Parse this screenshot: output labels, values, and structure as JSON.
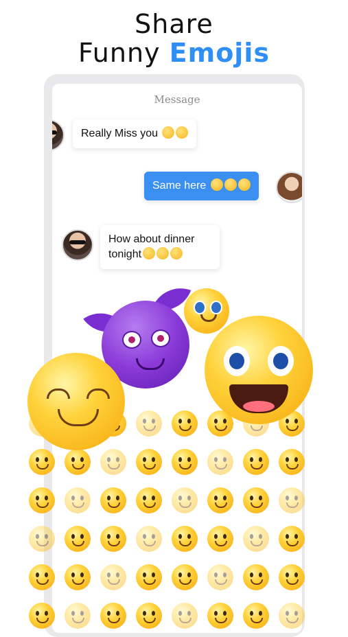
{
  "headline": {
    "line1": "Share",
    "line2_plain": "Funny",
    "line2_accent": "Emojis"
  },
  "colors": {
    "accent": "#2f8ff5",
    "sent_bubble": "#3a8ff0",
    "emoji_yellow": "#ffd23b",
    "devil_purple": "#8b3ad8"
  },
  "chat": {
    "title": "Message",
    "messages": [
      {
        "from": "other",
        "text": "Really Miss you",
        "emoji_count": 2
      },
      {
        "from": "me",
        "text": "Same here",
        "emoji_count": 3
      },
      {
        "from": "other",
        "text_line1": "How about dinner",
        "text_line2": "tonight",
        "emoji_count": 3
      }
    ]
  },
  "icons": {
    "avatar_other": "male-avatar-sunglasses",
    "avatar_me": "female-avatar",
    "devil": "smiling-devil-emoji",
    "featured": [
      "smiling-face-emoji",
      "laughing-face-emoji",
      "cute-face-emoji"
    ],
    "grid": "emoji-keyboard-grid"
  }
}
